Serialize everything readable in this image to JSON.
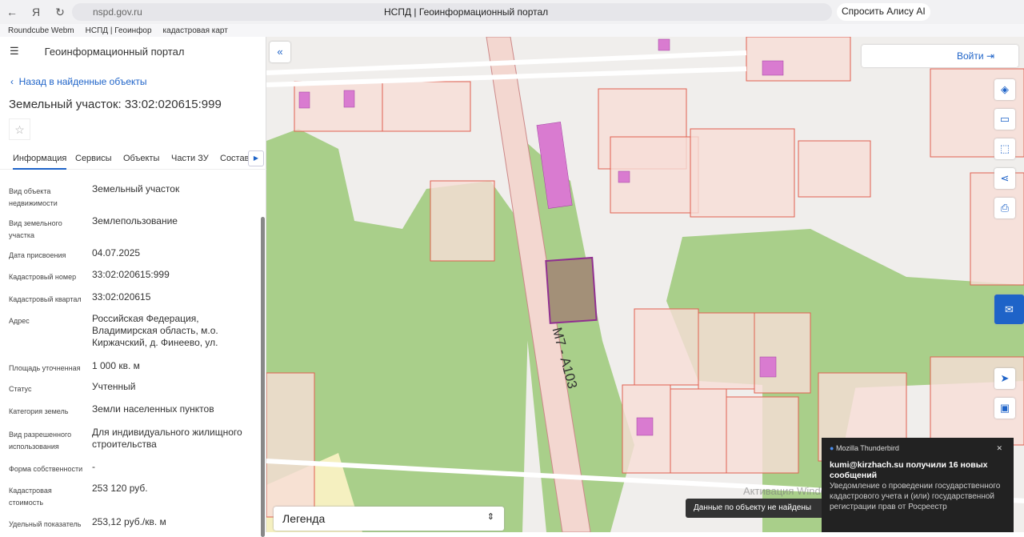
{
  "browser": {
    "url": "nspd.gov.ru",
    "title": "НСПД | Геоинформационный портал",
    "alice": "Спросить Алису AI",
    "bookmarks": [
      "Roundcube Webm",
      "НСПД | Геоинфор",
      "кадастровая карт"
    ]
  },
  "app": {
    "title": "Геоинформационный портал",
    "back": "Назад в найденные объекты",
    "heading": "Земельный участок: 33:02:020615:999",
    "tabs": [
      "Информация",
      "Сервисы",
      "Объекты",
      "Части ЗУ",
      "Состав"
    ],
    "fields": [
      {
        "label": "Вид объекта недвижимости",
        "value": "Земельный участок"
      },
      {
        "label": "Вид земельного участка",
        "value": "Землепользование"
      },
      {
        "label": "Дата присвоения",
        "value": "04.07.2025"
      },
      {
        "label": "Кадастровый номер",
        "value": "33:02:020615:999"
      },
      {
        "label": "Кадастровый квартал",
        "value": "33:02:020615"
      },
      {
        "label": "Адрес",
        "value": "Российская Федерация, Владимирская область, м.о. Киржачский, д. Финеево, ул."
      },
      {
        "label": "Площадь уточненная",
        "value": "1 000 кв. м"
      },
      {
        "label": "Статус",
        "value": "Учтенный"
      },
      {
        "label": "Категория земель",
        "value": "Земли населенных пунктов"
      },
      {
        "label": "Вид разрешенного использования",
        "value": "Для индивидуального жилищного строительства"
      },
      {
        "label": "Форма собственности",
        "value": "-"
      },
      {
        "label": "Кадастровая стоимость",
        "value": "253 120 руб."
      },
      {
        "label": "Удельный показатель",
        "value": "253,12 руб./кв. м"
      }
    ]
  },
  "map": {
    "login": "Войти",
    "legend": "Легенда",
    "road": "М7 - А103",
    "toast": "Данные по объекту не найдены",
    "watermark": "Активация Windows"
  },
  "notification": {
    "app": "Mozilla Thunderbird",
    "title": "kumi@kirzhach.su получили 16 новых сообщений",
    "body": "Уведомление о проведении государственного кадастрового учета и (или) государственной регистрации прав от Росреестр"
  }
}
